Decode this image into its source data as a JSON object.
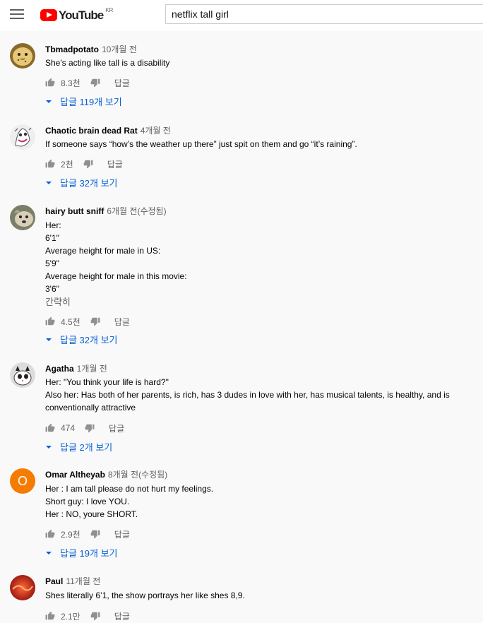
{
  "header": {
    "logo_text": "YouTube",
    "region": "KR",
    "search_value": "netflix tall girl"
  },
  "comments": [
    {
      "author": "Tbmadpotato",
      "time": "10개월 전",
      "text": "She's acting like tall is a disability",
      "likes": "8.3천",
      "reply_label": "답글",
      "replies_label": "답글 119개 보기"
    },
    {
      "author": "Chaotic brain dead Rat",
      "time": "4개월 전",
      "text": "If someone says “how’s the weather up there” just spit on them and go “it’s raining”.",
      "likes": "2천",
      "reply_label": "답글",
      "replies_label": "답글 32개 보기"
    },
    {
      "author": "hairy butt sniff",
      "time": "6개월 전(수정됨)",
      "text": "Her:\n6'1\"\nAverage height for male in US:\n5'9\"\nAverage height for male in this movie:\n3'6\"",
      "more_label": "간략히",
      "likes": "4.5천",
      "reply_label": "답글",
      "replies_label": "답글 32개 보기"
    },
    {
      "author": "Agatha",
      "time": "1개월 전",
      "text": "Her: \"You think your life is hard?\"\nAlso her: Has both of her parents, is rich, has 3 dudes in love with her, has musical talents, is healthy, and is conventionally attractive",
      "likes": "474",
      "reply_label": "답글",
      "replies_label": "답글 2개 보기"
    },
    {
      "author": "Omar Altheyab",
      "time": "8개월 전(수정됨)",
      "avatar_letter": "O",
      "text": "Her : I am tall please do not hurt my feelings.\nShort guy: I love YOU.\nHer : NO, youre SHORT.",
      "likes": "2.9천",
      "reply_label": "답글",
      "replies_label": "답글 19개 보기"
    },
    {
      "author": "Paul",
      "time": "11개월 전",
      "text": "Shes literally 6’1, the show portrays her like shes 8,9.",
      "likes": "2.1만",
      "reply_label": "답글"
    }
  ],
  "colors": {
    "link_blue": "#065fd4",
    "meta_gray": "#606060",
    "brand_red": "#ff0000",
    "omar_avatar": "#f57c00"
  }
}
